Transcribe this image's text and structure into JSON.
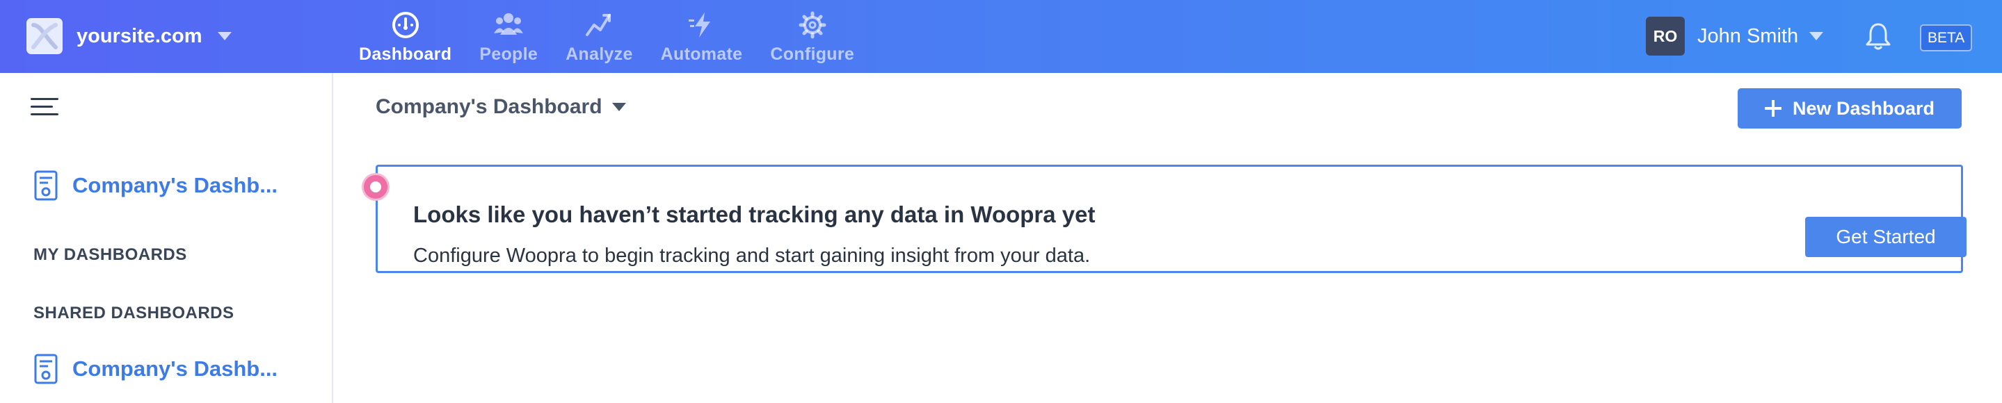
{
  "header": {
    "site_name": "yoursite.com",
    "nav": [
      {
        "label": "Dashboard",
        "icon": "dashboard-gauge-icon",
        "active": true
      },
      {
        "label": "People",
        "icon": "people-icon",
        "active": false
      },
      {
        "label": "Analyze",
        "icon": "trend-line-icon",
        "active": false
      },
      {
        "label": "Automate",
        "icon": "lightning-icon",
        "active": false
      },
      {
        "label": "Configure",
        "icon": "gear-icon",
        "active": false
      }
    ],
    "user": {
      "initials": "RO",
      "name": "John Smith"
    },
    "badge": "BETA",
    "colors": {
      "gradient_start": "#5566f5",
      "gradient_end": "#3e8ef3"
    }
  },
  "sidebar": {
    "primary_dashboard": "Company's Dashb...",
    "my_dashboards_heading": "MY DASHBOARDS",
    "shared_dashboards_heading": "SHARED DASHBOARDS",
    "shared_items": [
      {
        "label": "Company's Dashb..."
      }
    ]
  },
  "main": {
    "dashboard_selector": "Company's Dashboard",
    "new_dashboard_button": "New Dashboard",
    "notice": {
      "title": "Looks like you haven’t started tracking any data in Woopra yet",
      "text": "Configure Woopra to begin tracking and start gaining insight from your data.",
      "button": "Get Started"
    },
    "accent_color": "#4b86ec"
  }
}
